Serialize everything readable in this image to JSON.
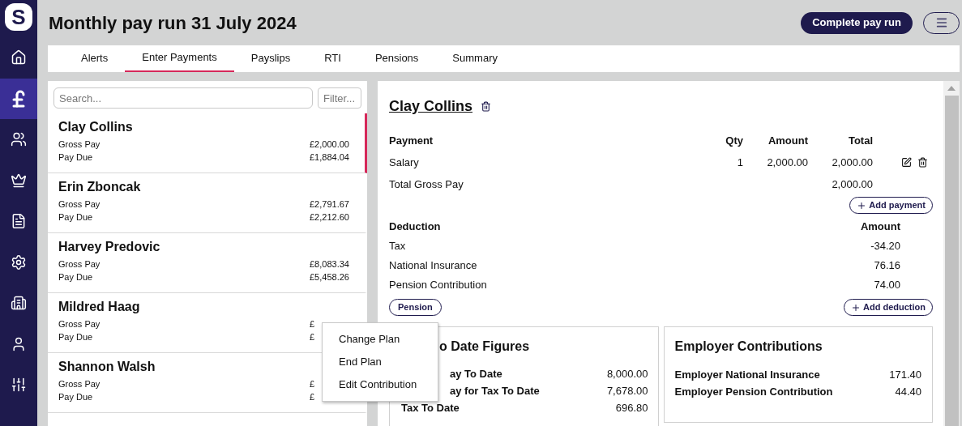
{
  "sidebar": {
    "logo": "S",
    "items": [
      {
        "selected": false
      },
      {
        "selected": true
      },
      {
        "selected": false
      },
      {
        "selected": false
      },
      {
        "selected": false
      },
      {
        "selected": false
      },
      {
        "selected": false
      },
      {
        "selected": false
      },
      {
        "selected": false
      }
    ]
  },
  "header": {
    "title": "Monthly pay run 31 July 2024",
    "primary_button": "Complete pay run"
  },
  "tabs": [
    {
      "label": "Alerts",
      "selected": false
    },
    {
      "label": "Enter Payments",
      "selected": true
    },
    {
      "label": "Payslips",
      "selected": false
    },
    {
      "label": "RTI",
      "selected": false
    },
    {
      "label": "Pensions",
      "selected": false
    },
    {
      "label": "Summary",
      "selected": false
    }
  ],
  "employee_list": {
    "search_placeholder": "Search...",
    "filter_placeholder": "Filter...",
    "employees": [
      {
        "name": "Clay Collins",
        "selected": true,
        "rows": [
          {
            "label": "Gross Pay",
            "value": "£2,000.00"
          },
          {
            "label": "Pay Due",
            "value": "£1,884.04"
          }
        ]
      },
      {
        "name": "Erin Zboncak",
        "selected": false,
        "rows": [
          {
            "label": "Gross Pay",
            "value": "£2,791.67"
          },
          {
            "label": "Pay Due",
            "value": "£2,212.60"
          }
        ]
      },
      {
        "name": "Harvey Predovic",
        "selected": false,
        "rows": [
          {
            "label": "Gross Pay",
            "value": "£8,083.34"
          },
          {
            "label": "Pay Due",
            "value": "£5,458.26"
          }
        ]
      },
      {
        "name": "Mildred Haag",
        "selected": false,
        "rows": [
          {
            "label": "Gross Pay",
            "value": "£"
          },
          {
            "label": "Pay Due",
            "value": "£"
          }
        ]
      },
      {
        "name": "Shannon Walsh",
        "selected": false,
        "rows": [
          {
            "label": "Gross Pay",
            "value": "£"
          },
          {
            "label": "Pay Due",
            "value": "£"
          }
        ]
      }
    ]
  },
  "detail": {
    "name": "Clay Collins",
    "payment_table": {
      "columns": [
        "Payment",
        "Qty",
        "Amount",
        "Total"
      ],
      "rows": [
        {
          "kind": "item",
          "cells": [
            "Salary",
            "1",
            "2,000.00",
            "2,000.00"
          ]
        },
        {
          "kind": "total",
          "cells": [
            "Total Gross Pay",
            "",
            "",
            "2,000.00"
          ]
        }
      ]
    },
    "add_payment": "Add payment",
    "deduction_table": {
      "columns": [
        "Deduction",
        "Amount"
      ],
      "rows": [
        {
          "label": "Tax",
          "value": "-34.20"
        },
        {
          "label": "National Insurance",
          "value": "76.16"
        },
        {
          "label": "Pension Contribution",
          "value": "74.00"
        }
      ]
    },
    "tag": "Pension",
    "add_deduction": "Add deduction",
    "ytd": {
      "title": "o Date Figures",
      "covered": true,
      "rows": [
        {
          "label": "ay To Date",
          "value": "8,000.00",
          "covered": true
        },
        {
          "label": "ay for Tax To Date",
          "value": "7,678.00",
          "covered": true
        },
        {
          "label": "Tax To Date",
          "value": "696.80",
          "covered": false
        }
      ]
    },
    "employer": {
      "title": "Employer Contributions",
      "rows": [
        {
          "label": "Employer National Insurance",
          "value": "171.40"
        },
        {
          "label": "Employer Pension Contribution",
          "value": "44.40"
        }
      ]
    }
  },
  "context_menu": {
    "items": [
      "Change Plan",
      "End Plan",
      "Edit Contribution"
    ]
  }
}
